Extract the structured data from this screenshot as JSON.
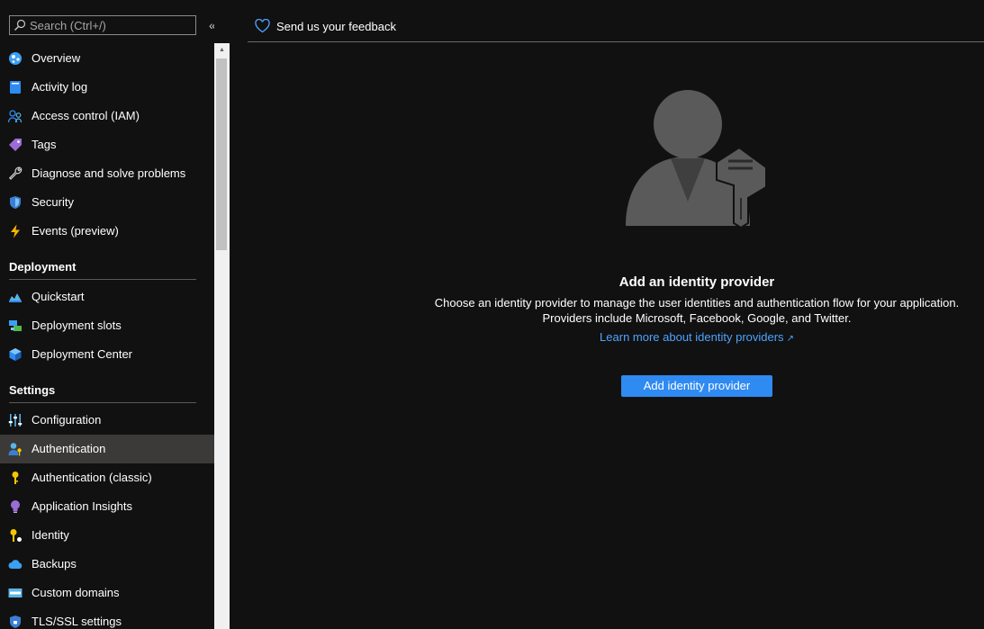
{
  "search": {
    "placeholder": "Search (Ctrl+/)"
  },
  "collapse_glyph": "«",
  "nav": {
    "top_items": [
      {
        "label": "Overview",
        "icon": "overview-icon",
        "color": "#3aa0f3"
      },
      {
        "label": "Activity log",
        "icon": "activity-log-icon",
        "color": "#2f8af2"
      },
      {
        "label": "Access control (IAM)",
        "icon": "access-control-icon",
        "color": "#2f8af2"
      },
      {
        "label": "Tags",
        "icon": "tag-icon",
        "color": "#9b6cd6"
      },
      {
        "label": "Diagnose and solve problems",
        "icon": "wrench-icon",
        "color": "#d0d0d0"
      },
      {
        "label": "Security",
        "icon": "shield-icon",
        "color": "#3a7fd5"
      },
      {
        "label": "Events (preview)",
        "icon": "lightning-icon",
        "color": "#f7b500"
      }
    ],
    "deployment": {
      "heading": "Deployment",
      "items": [
        {
          "label": "Quickstart",
          "icon": "quickstart-icon",
          "color": "#5ab4e8"
        },
        {
          "label": "Deployment slots",
          "icon": "deployment-slots-icon",
          "color": "#4fb848"
        },
        {
          "label": "Deployment Center",
          "icon": "cube-icon",
          "color": "#2f8af2"
        }
      ]
    },
    "settings": {
      "heading": "Settings",
      "items": [
        {
          "label": "Configuration",
          "icon": "sliders-icon",
          "color": "#5ab4e8"
        },
        {
          "label": "Authentication",
          "icon": "user-key-icon",
          "color": "#5ab4e8",
          "active": true
        },
        {
          "label": "Authentication (classic)",
          "icon": "key-icon",
          "color": "#f7c600"
        },
        {
          "label": "Application Insights",
          "icon": "lightbulb-icon",
          "color": "#9b6cd6"
        },
        {
          "label": "Identity",
          "icon": "identity-key-icon",
          "color": "#f7c600"
        },
        {
          "label": "Backups",
          "icon": "cloud-icon",
          "color": "#3aa0f3"
        },
        {
          "label": "Custom domains",
          "icon": "domain-icon",
          "color": "#5ab4e8"
        },
        {
          "label": "TLS/SSL settings",
          "icon": "tls-shield-icon",
          "color": "#3a7fd5"
        }
      ]
    }
  },
  "toolbar": {
    "feedback_label": "Send us your feedback"
  },
  "empty_state": {
    "title": "Add an identity provider",
    "description_line1": "Choose an identity provider to manage the user identities and authentication flow for your application.",
    "description_line2": "Providers include Microsoft, Facebook, Google, and Twitter.",
    "link_label": "Learn more about identity providers",
    "button_label": "Add identity provider"
  },
  "colors": {
    "background": "#111111",
    "accent": "#2f8af2",
    "link": "#4da3ff",
    "active_row": "#3b3a39"
  }
}
